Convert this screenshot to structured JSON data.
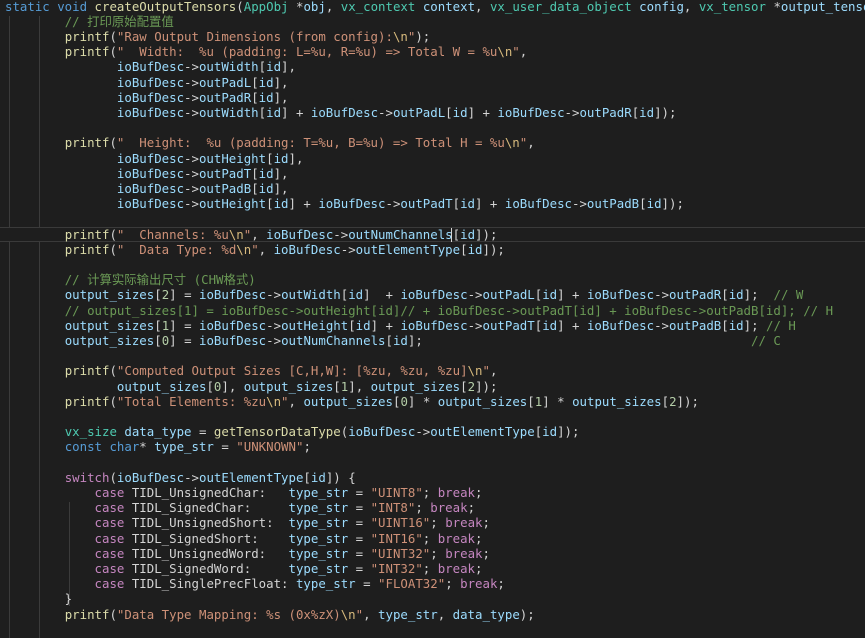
{
  "colors": {
    "background": "#1e1e1e",
    "default": "#d4d4d4",
    "keyword": "#569cd6",
    "control": "#c586c0",
    "function": "#dcdcaa",
    "type": "#4ec9b0",
    "param": "#9cdcfe",
    "string": "#ce9178",
    "number": "#b5cea8",
    "comment": "#6a9955",
    "escape": "#d7ba7d"
  },
  "lines": [
    [
      [
        "k",
        "static "
      ],
      [
        "k",
        "void "
      ],
      [
        "f",
        "createOutputTensors"
      ],
      [
        "p",
        "("
      ],
      [
        "ty",
        "AppObj "
      ],
      [
        "p",
        "*"
      ],
      [
        "v",
        "obj"
      ],
      [
        "p",
        ", "
      ],
      [
        "ty",
        "vx_context "
      ],
      [
        "v",
        "context"
      ],
      [
        "p",
        ", "
      ],
      [
        "ty",
        "vx_user_data_object "
      ],
      [
        "v",
        "config"
      ],
      [
        "p",
        ", "
      ],
      [
        "ty",
        "vx_tensor "
      ],
      [
        "p",
        "*"
      ],
      [
        "v",
        "output_tensors"
      ],
      [
        "p",
        ")"
      ]
    ],
    [
      [
        "p",
        "        "
      ],
      [
        "c",
        "// 打印原始配置值"
      ]
    ],
    [
      [
        "p",
        "        "
      ],
      [
        "f",
        "printf"
      ],
      [
        "p",
        "("
      ],
      [
        "s",
        "\"Raw Output Dimensions (from config):"
      ],
      [
        "e",
        "\\n"
      ],
      [
        "s",
        "\""
      ],
      [
        "p",
        ");"
      ]
    ],
    [
      [
        "p",
        "        "
      ],
      [
        "f",
        "printf"
      ],
      [
        "p",
        "("
      ],
      [
        "s",
        "\"  Width:  %u (padding: L=%u, R=%u) => Total W = %u"
      ],
      [
        "e",
        "\\n"
      ],
      [
        "s",
        "\""
      ],
      [
        "p",
        ","
      ]
    ],
    [
      [
        "p",
        "               "
      ],
      [
        "v",
        "ioBufDesc"
      ],
      [
        "p",
        "->"
      ],
      [
        "v",
        "outWidth"
      ],
      [
        "p",
        "["
      ],
      [
        "v",
        "id"
      ],
      [
        "p",
        "],"
      ]
    ],
    [
      [
        "p",
        "               "
      ],
      [
        "v",
        "ioBufDesc"
      ],
      [
        "p",
        "->"
      ],
      [
        "v",
        "outPadL"
      ],
      [
        "p",
        "["
      ],
      [
        "v",
        "id"
      ],
      [
        "p",
        "],"
      ]
    ],
    [
      [
        "p",
        "               "
      ],
      [
        "v",
        "ioBufDesc"
      ],
      [
        "p",
        "->"
      ],
      [
        "v",
        "outPadR"
      ],
      [
        "p",
        "["
      ],
      [
        "v",
        "id"
      ],
      [
        "p",
        "],"
      ]
    ],
    [
      [
        "p",
        "               "
      ],
      [
        "v",
        "ioBufDesc"
      ],
      [
        "p",
        "->"
      ],
      [
        "v",
        "outWidth"
      ],
      [
        "p",
        "["
      ],
      [
        "v",
        "id"
      ],
      [
        "p",
        "] + "
      ],
      [
        "v",
        "ioBufDesc"
      ],
      [
        "p",
        "->"
      ],
      [
        "v",
        "outPadL"
      ],
      [
        "p",
        "["
      ],
      [
        "v",
        "id"
      ],
      [
        "p",
        "] + "
      ],
      [
        "v",
        "ioBufDesc"
      ],
      [
        "p",
        "->"
      ],
      [
        "v",
        "outPadR"
      ],
      [
        "p",
        "["
      ],
      [
        "v",
        "id"
      ],
      [
        "p",
        "]);"
      ]
    ],
    [],
    [
      [
        "p",
        "        "
      ],
      [
        "f",
        "printf"
      ],
      [
        "p",
        "("
      ],
      [
        "s",
        "\"  Height:  %u (padding: T=%u, B=%u) => Total H = %u"
      ],
      [
        "e",
        "\\n"
      ],
      [
        "s",
        "\""
      ],
      [
        "p",
        ","
      ]
    ],
    [
      [
        "p",
        "               "
      ],
      [
        "v",
        "ioBufDesc"
      ],
      [
        "p",
        "->"
      ],
      [
        "v",
        "outHeight"
      ],
      [
        "p",
        "["
      ],
      [
        "v",
        "id"
      ],
      [
        "p",
        "],"
      ]
    ],
    [
      [
        "p",
        "               "
      ],
      [
        "v",
        "ioBufDesc"
      ],
      [
        "p",
        "->"
      ],
      [
        "v",
        "outPadT"
      ],
      [
        "p",
        "["
      ],
      [
        "v",
        "id"
      ],
      [
        "p",
        "],"
      ]
    ],
    [
      [
        "p",
        "               "
      ],
      [
        "v",
        "ioBufDesc"
      ],
      [
        "p",
        "->"
      ],
      [
        "v",
        "outPadB"
      ],
      [
        "p",
        "["
      ],
      [
        "v",
        "id"
      ],
      [
        "p",
        "],"
      ]
    ],
    [
      [
        "p",
        "               "
      ],
      [
        "v",
        "ioBufDesc"
      ],
      [
        "p",
        "->"
      ],
      [
        "v",
        "outHeight"
      ],
      [
        "p",
        "["
      ],
      [
        "v",
        "id"
      ],
      [
        "p",
        "] + "
      ],
      [
        "v",
        "ioBufDesc"
      ],
      [
        "p",
        "->"
      ],
      [
        "v",
        "outPadT"
      ],
      [
        "p",
        "["
      ],
      [
        "v",
        "id"
      ],
      [
        "p",
        "] + "
      ],
      [
        "v",
        "ioBufDesc"
      ],
      [
        "p",
        "->"
      ],
      [
        "v",
        "outPadB"
      ],
      [
        "p",
        "["
      ],
      [
        "v",
        "id"
      ],
      [
        "p",
        "]);"
      ]
    ],
    [],
    [
      [
        "p",
        "        "
      ],
      [
        "f",
        "printf"
      ],
      [
        "p",
        "("
      ],
      [
        "s",
        "\"  Channels: %u"
      ],
      [
        "e",
        "\\n"
      ],
      [
        "s",
        "\""
      ],
      [
        "p",
        ", "
      ],
      [
        "v",
        "ioBufDesc"
      ],
      [
        "p",
        "->"
      ],
      [
        "v",
        "outNumChannels"
      ],
      [
        "p",
        "["
      ],
      [
        "v",
        "id"
      ],
      [
        "p",
        "]);"
      ]
    ],
    [
      [
        "p",
        "        "
      ],
      [
        "f",
        "printf"
      ],
      [
        "p",
        "("
      ],
      [
        "s",
        "\"  Data Type: %d"
      ],
      [
        "e",
        "\\n"
      ],
      [
        "s",
        "\""
      ],
      [
        "p",
        ", "
      ],
      [
        "v",
        "ioBufDesc"
      ],
      [
        "p",
        "->"
      ],
      [
        "v",
        "outElementType"
      ],
      [
        "p",
        "["
      ],
      [
        "v",
        "id"
      ],
      [
        "p",
        "]);"
      ]
    ],
    [],
    [
      [
        "p",
        "        "
      ],
      [
        "c",
        "// 计算实际输出尺寸 (CHW格式)"
      ]
    ],
    [
      [
        "p",
        "        "
      ],
      [
        "v",
        "output_sizes"
      ],
      [
        "p",
        "["
      ],
      [
        "n",
        "2"
      ],
      [
        "p",
        "] = "
      ],
      [
        "v",
        "ioBufDesc"
      ],
      [
        "p",
        "->"
      ],
      [
        "v",
        "outWidth"
      ],
      [
        "p",
        "["
      ],
      [
        "v",
        "id"
      ],
      [
        "p",
        "]  + "
      ],
      [
        "v",
        "ioBufDesc"
      ],
      [
        "p",
        "->"
      ],
      [
        "v",
        "outPadL"
      ],
      [
        "p",
        "["
      ],
      [
        "v",
        "id"
      ],
      [
        "p",
        "] + "
      ],
      [
        "v",
        "ioBufDesc"
      ],
      [
        "p",
        "->"
      ],
      [
        "v",
        "outPadR"
      ],
      [
        "p",
        "["
      ],
      [
        "v",
        "id"
      ],
      [
        "p",
        "];  "
      ],
      [
        "c",
        "// W"
      ]
    ],
    [
      [
        "p",
        "        "
      ],
      [
        "c",
        "// output_sizes[1] = ioBufDesc->outHeight[id]// + ioBufDesc->outPadT[id] + ioBufDesc->outPadB[id]; // H"
      ]
    ],
    [
      [
        "p",
        "        "
      ],
      [
        "v",
        "output_sizes"
      ],
      [
        "p",
        "["
      ],
      [
        "n",
        "1"
      ],
      [
        "p",
        "] = "
      ],
      [
        "v",
        "ioBufDesc"
      ],
      [
        "p",
        "->"
      ],
      [
        "v",
        "outHeight"
      ],
      [
        "p",
        "["
      ],
      [
        "v",
        "id"
      ],
      [
        "p",
        "] + "
      ],
      [
        "v",
        "ioBufDesc"
      ],
      [
        "p",
        "->"
      ],
      [
        "v",
        "outPadT"
      ],
      [
        "p",
        "["
      ],
      [
        "v",
        "id"
      ],
      [
        "p",
        "] + "
      ],
      [
        "v",
        "ioBufDesc"
      ],
      [
        "p",
        "->"
      ],
      [
        "v",
        "outPadB"
      ],
      [
        "p",
        "["
      ],
      [
        "v",
        "id"
      ],
      [
        "p",
        "]; "
      ],
      [
        "c",
        "// H"
      ]
    ],
    [
      [
        "p",
        "        "
      ],
      [
        "v",
        "output_sizes"
      ],
      [
        "p",
        "["
      ],
      [
        "n",
        "0"
      ],
      [
        "p",
        "] = "
      ],
      [
        "v",
        "ioBufDesc"
      ],
      [
        "p",
        "->"
      ],
      [
        "v",
        "outNumChannels"
      ],
      [
        "p",
        "["
      ],
      [
        "v",
        "id"
      ],
      [
        "p",
        "];                                            "
      ],
      [
        "c",
        "// C"
      ]
    ],
    [],
    [
      [
        "p",
        "        "
      ],
      [
        "f",
        "printf"
      ],
      [
        "p",
        "("
      ],
      [
        "s",
        "\"Computed Output Sizes [C,H,W]: [%zu, %zu, %zu]"
      ],
      [
        "e",
        "\\n"
      ],
      [
        "s",
        "\""
      ],
      [
        "p",
        ","
      ]
    ],
    [
      [
        "p",
        "               "
      ],
      [
        "v",
        "output_sizes"
      ],
      [
        "p",
        "["
      ],
      [
        "n",
        "0"
      ],
      [
        "p",
        "], "
      ],
      [
        "v",
        "output_sizes"
      ],
      [
        "p",
        "["
      ],
      [
        "n",
        "1"
      ],
      [
        "p",
        "], "
      ],
      [
        "v",
        "output_sizes"
      ],
      [
        "p",
        "["
      ],
      [
        "n",
        "2"
      ],
      [
        "p",
        "]);"
      ]
    ],
    [
      [
        "p",
        "        "
      ],
      [
        "f",
        "printf"
      ],
      [
        "p",
        "("
      ],
      [
        "s",
        "\"Total Elements: %zu"
      ],
      [
        "e",
        "\\n"
      ],
      [
        "s",
        "\""
      ],
      [
        "p",
        ", "
      ],
      [
        "v",
        "output_sizes"
      ],
      [
        "p",
        "["
      ],
      [
        "n",
        "0"
      ],
      [
        "p",
        "] * "
      ],
      [
        "v",
        "output_sizes"
      ],
      [
        "p",
        "["
      ],
      [
        "n",
        "1"
      ],
      [
        "p",
        "] * "
      ],
      [
        "v",
        "output_sizes"
      ],
      [
        "p",
        "["
      ],
      [
        "n",
        "2"
      ],
      [
        "p",
        "]);"
      ]
    ],
    [],
    [
      [
        "p",
        "        "
      ],
      [
        "ty",
        "vx_size "
      ],
      [
        "v",
        "data_type"
      ],
      [
        "p",
        " = "
      ],
      [
        "f",
        "getTensorDataType"
      ],
      [
        "p",
        "("
      ],
      [
        "v",
        "ioBufDesc"
      ],
      [
        "p",
        "->"
      ],
      [
        "v",
        "outElementType"
      ],
      [
        "p",
        "["
      ],
      [
        "v",
        "id"
      ],
      [
        "p",
        "]);"
      ]
    ],
    [
      [
        "p",
        "        "
      ],
      [
        "k",
        "const "
      ],
      [
        "k",
        "char"
      ],
      [
        "p",
        "* "
      ],
      [
        "v",
        "type_str"
      ],
      [
        "p",
        " = "
      ],
      [
        "s",
        "\"UNKNOWN\""
      ],
      [
        "p",
        ";"
      ]
    ],
    [],
    [
      [
        "p",
        "        "
      ],
      [
        "x",
        "switch"
      ],
      [
        "p",
        "("
      ],
      [
        "v",
        "ioBufDesc"
      ],
      [
        "p",
        "->"
      ],
      [
        "v",
        "outElementType"
      ],
      [
        "p",
        "["
      ],
      [
        "v",
        "id"
      ],
      [
        "p",
        "]) {"
      ]
    ],
    [
      [
        "p",
        "            "
      ],
      [
        "x",
        "case "
      ],
      [
        "p",
        "TIDL_UnsignedChar:   "
      ],
      [
        "v",
        "type_str"
      ],
      [
        "p",
        " = "
      ],
      [
        "s",
        "\"UINT8\""
      ],
      [
        "p",
        "; "
      ],
      [
        "x",
        "break"
      ],
      [
        "p",
        ";"
      ]
    ],
    [
      [
        "p",
        "            "
      ],
      [
        "x",
        "case "
      ],
      [
        "p",
        "TIDL_SignedChar:     "
      ],
      [
        "v",
        "type_str"
      ],
      [
        "p",
        " = "
      ],
      [
        "s",
        "\"INT8\""
      ],
      [
        "p",
        "; "
      ],
      [
        "x",
        "break"
      ],
      [
        "p",
        ";"
      ]
    ],
    [
      [
        "p",
        "            "
      ],
      [
        "x",
        "case "
      ],
      [
        "p",
        "TIDL_UnsignedShort:  "
      ],
      [
        "v",
        "type_str"
      ],
      [
        "p",
        " = "
      ],
      [
        "s",
        "\"UINT16\""
      ],
      [
        "p",
        "; "
      ],
      [
        "x",
        "break"
      ],
      [
        "p",
        ";"
      ]
    ],
    [
      [
        "p",
        "            "
      ],
      [
        "x",
        "case "
      ],
      [
        "p",
        "TIDL_SignedShort:    "
      ],
      [
        "v",
        "type_str"
      ],
      [
        "p",
        " = "
      ],
      [
        "s",
        "\"INT16\""
      ],
      [
        "p",
        "; "
      ],
      [
        "x",
        "break"
      ],
      [
        "p",
        ";"
      ]
    ],
    [
      [
        "p",
        "            "
      ],
      [
        "x",
        "case "
      ],
      [
        "p",
        "TIDL_UnsignedWord:   "
      ],
      [
        "v",
        "type_str"
      ],
      [
        "p",
        " = "
      ],
      [
        "s",
        "\"UINT32\""
      ],
      [
        "p",
        "; "
      ],
      [
        "x",
        "break"
      ],
      [
        "p",
        ";"
      ]
    ],
    [
      [
        "p",
        "            "
      ],
      [
        "x",
        "case "
      ],
      [
        "p",
        "TIDL_SignedWord:     "
      ],
      [
        "v",
        "type_str"
      ],
      [
        "p",
        " = "
      ],
      [
        "s",
        "\"INT32\""
      ],
      [
        "p",
        "; "
      ],
      [
        "x",
        "break"
      ],
      [
        "p",
        ";"
      ]
    ],
    [
      [
        "p",
        "            "
      ],
      [
        "x",
        "case "
      ],
      [
        "p",
        "TIDL_SinglePrecFloat: "
      ],
      [
        "v",
        "type_str"
      ],
      [
        "p",
        " = "
      ],
      [
        "s",
        "\"FLOAT32\""
      ],
      [
        "p",
        "; "
      ],
      [
        "x",
        "break"
      ],
      [
        "p",
        ";"
      ]
    ],
    [
      [
        "p",
        "        }"
      ]
    ],
    [
      [
        "p",
        "        "
      ],
      [
        "f",
        "printf"
      ],
      [
        "p",
        "("
      ],
      [
        "s",
        "\"Data Type Mapping: %s (0x%zX)"
      ],
      [
        "e",
        "\\n"
      ],
      [
        "s",
        "\""
      ],
      [
        "p",
        ", "
      ],
      [
        "v",
        "type_str"
      ],
      [
        "p",
        ", "
      ],
      [
        "v",
        "data_type"
      ],
      [
        "p",
        ");"
      ]
    ]
  ]
}
